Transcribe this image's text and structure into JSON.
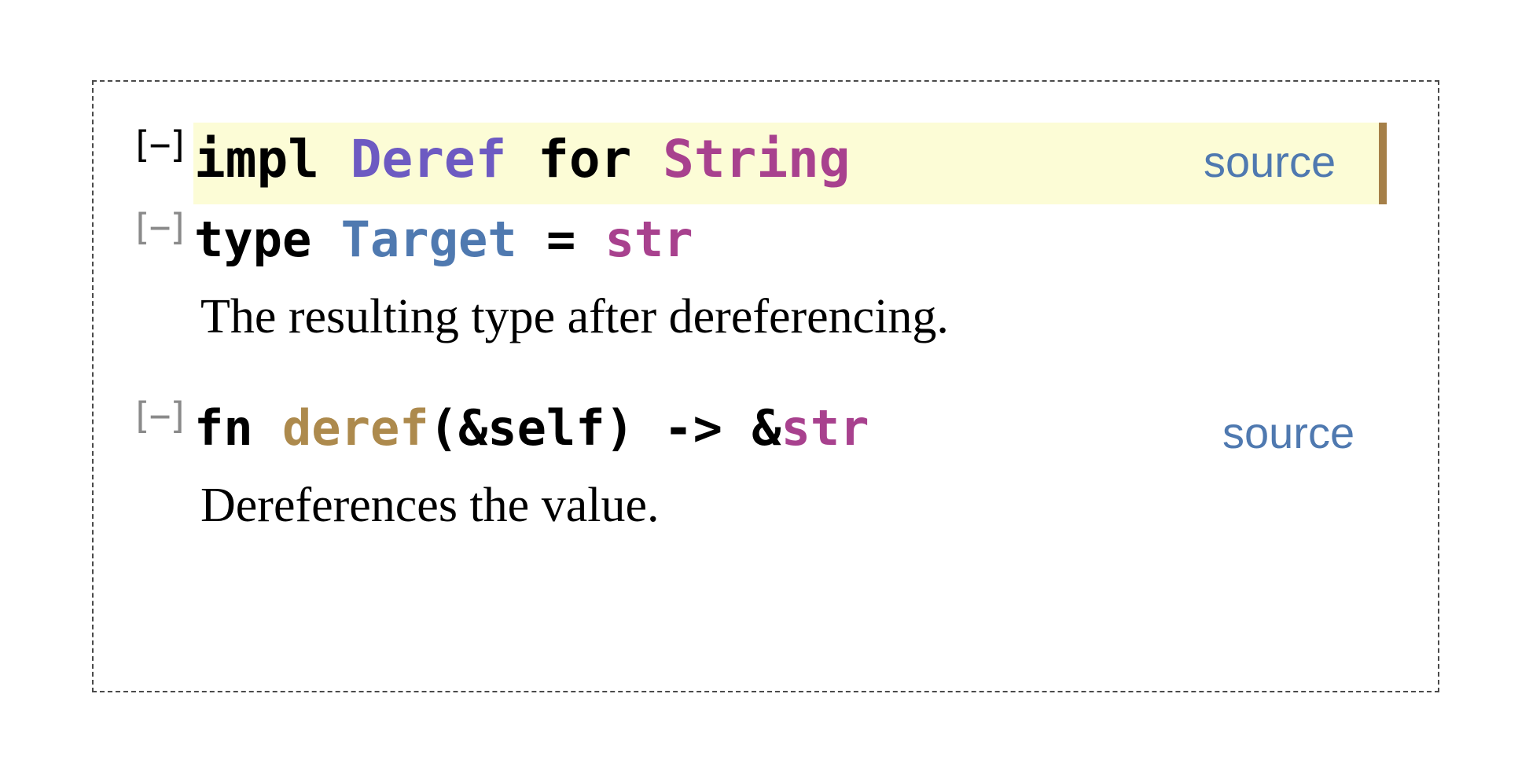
{
  "impl_block": {
    "toggle": "[−]",
    "keyword_impl": "impl",
    "trait_name": "Deref",
    "keyword_for": "for",
    "type_name": "String",
    "source_label": "source"
  },
  "assoc_type": {
    "toggle": "[−]",
    "keyword_type": "type",
    "name": "Target",
    "equals": "=",
    "value": "str",
    "doc": "The resulting type after dereferencing."
  },
  "method": {
    "toggle": "[−]",
    "keyword_fn": "fn",
    "name": "deref",
    "signature": "(&self) -> &",
    "return_type": "str",
    "source_label": "source",
    "doc": "Dereferences the value."
  },
  "colors": {
    "impl_highlight_bg": "#fcfcd6",
    "impl_highlight_border": "#a57f48",
    "trait": "#6d5ac2",
    "primitive": "#a8418e",
    "associated_type": "#4f79b0",
    "function": "#ad8a4d",
    "link": "#4f79b0"
  }
}
